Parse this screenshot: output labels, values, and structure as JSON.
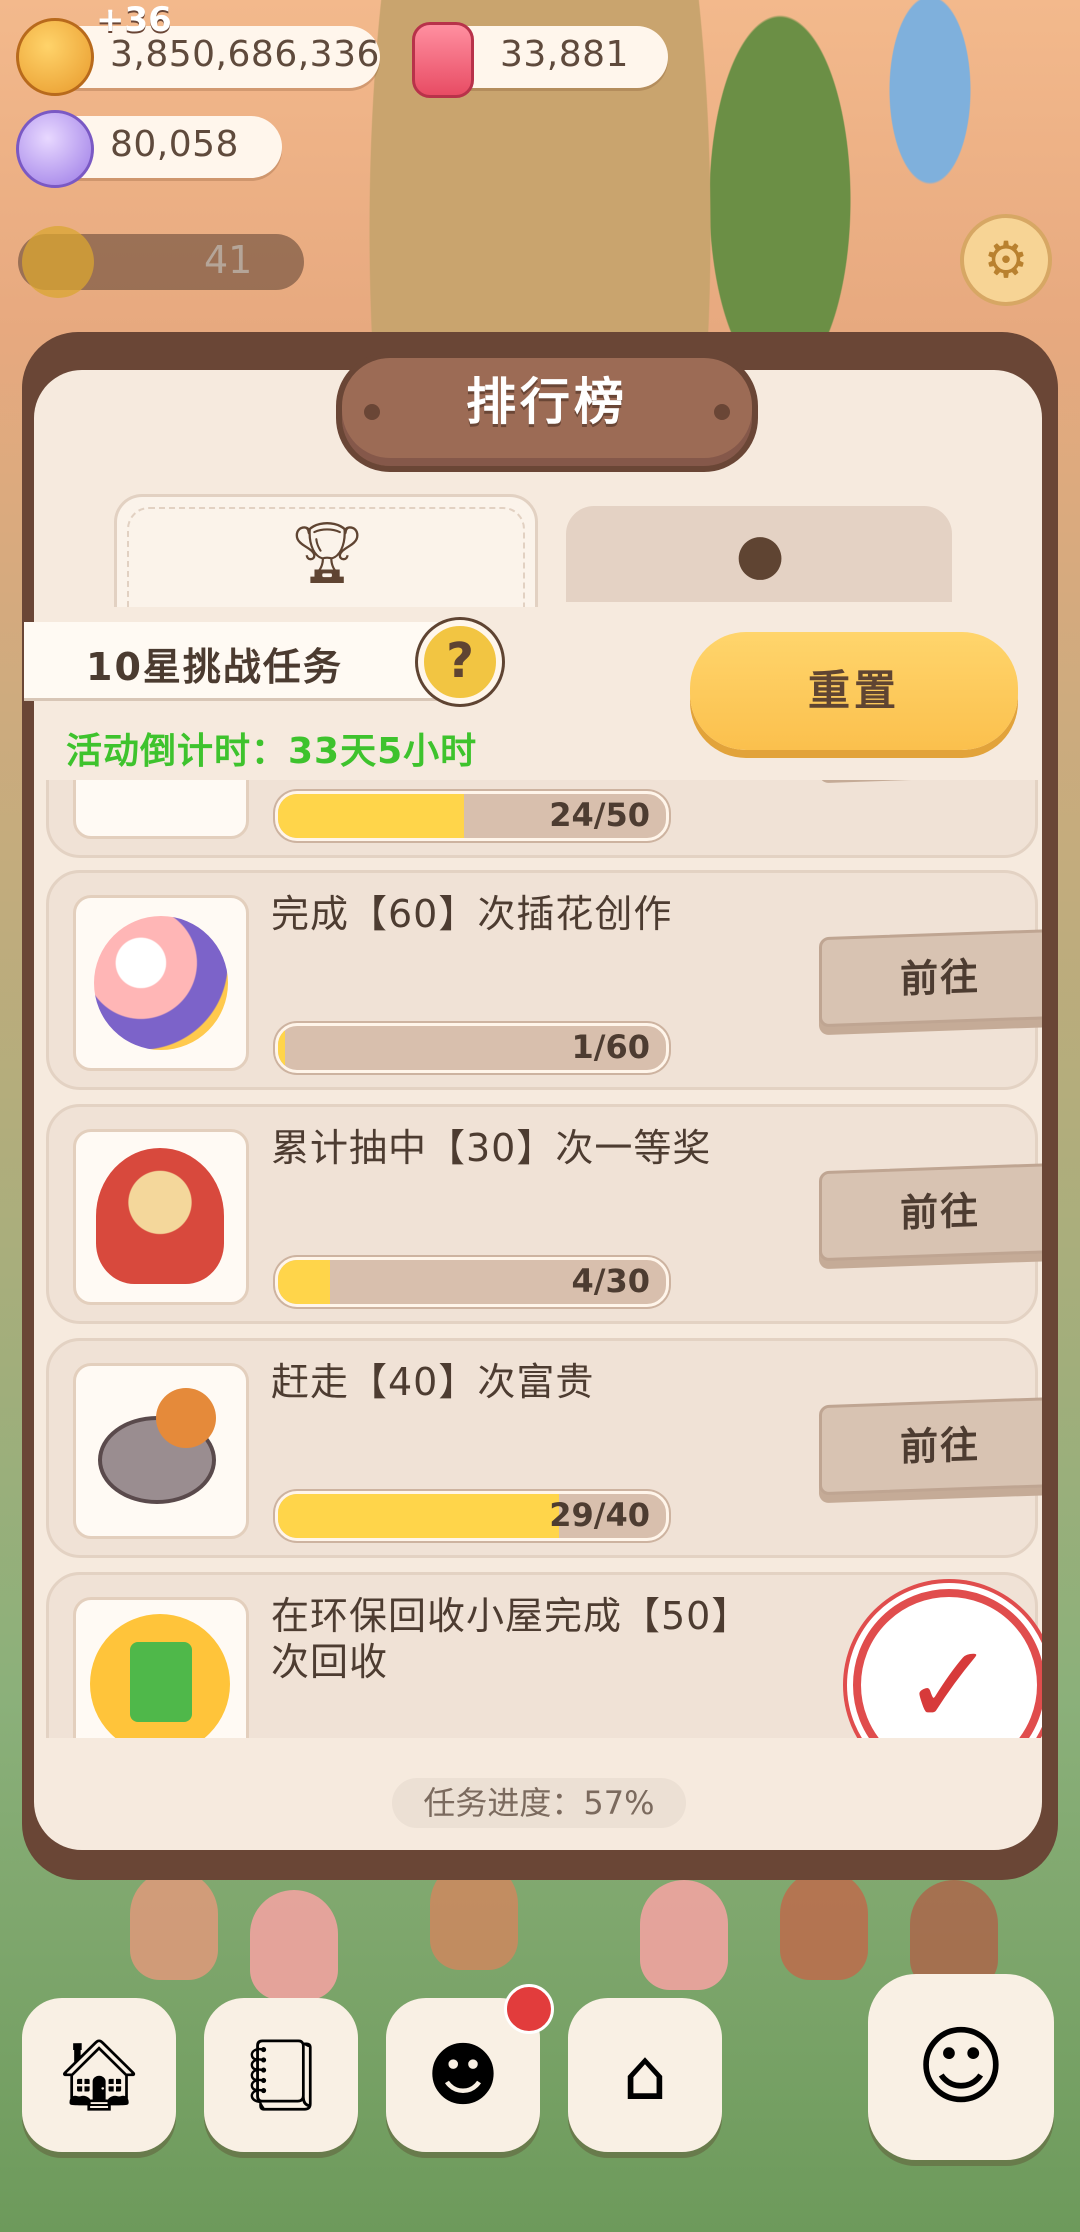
{
  "resources": {
    "coin_bonus": "+36",
    "coins": "3,850,686,336",
    "candles": "33,881",
    "gems": "80,058",
    "sun_count": "41"
  },
  "modal": {
    "title": "排行榜",
    "tabs": [
      {
        "icon": "trophy-icon"
      },
      {
        "icon": "mushroom-icon"
      }
    ],
    "task_label": "10星挑战任务",
    "help": "?",
    "countdown": "活动倒计时：33天5小时",
    "reset_label": "重置",
    "tasks": [
      {
        "title": "",
        "progress_text": "24/50",
        "progress": 0.48,
        "button": ""
      },
      {
        "title": "完成【60】次插花创作",
        "progress_text": "1/60",
        "progress": 0.017,
        "button": "前往",
        "icon": "flower-icon"
      },
      {
        "title": "累计抽中【30】次一等奖",
        "progress_text": "4/30",
        "progress": 0.133,
        "button": "前往",
        "icon": "lottery-machine-icon"
      },
      {
        "title": "赶走【40】次富贵",
        "progress_text": "29/40",
        "progress": 0.725,
        "button": "前往",
        "icon": "mouse-icon"
      },
      {
        "title": "在环保回收小屋完成【50】次回收",
        "progress_text": "",
        "progress": 0,
        "button": "",
        "icon": "recycle-bin-icon",
        "completed": true
      }
    ],
    "summary": "任务进度：57%"
  },
  "bottom_nav": [
    {
      "icon": "house-icon"
    },
    {
      "icon": "notebook-icon"
    },
    {
      "icon": "chef-icon"
    },
    {
      "icon": "shop-icon"
    },
    {
      "icon": "pet-icon"
    }
  ],
  "colors": {
    "accent": "#fbc04d",
    "progress_fill": "#ffd54a",
    "countdown_green": "#3ec32d",
    "stamp_red": "#e04d4d"
  }
}
